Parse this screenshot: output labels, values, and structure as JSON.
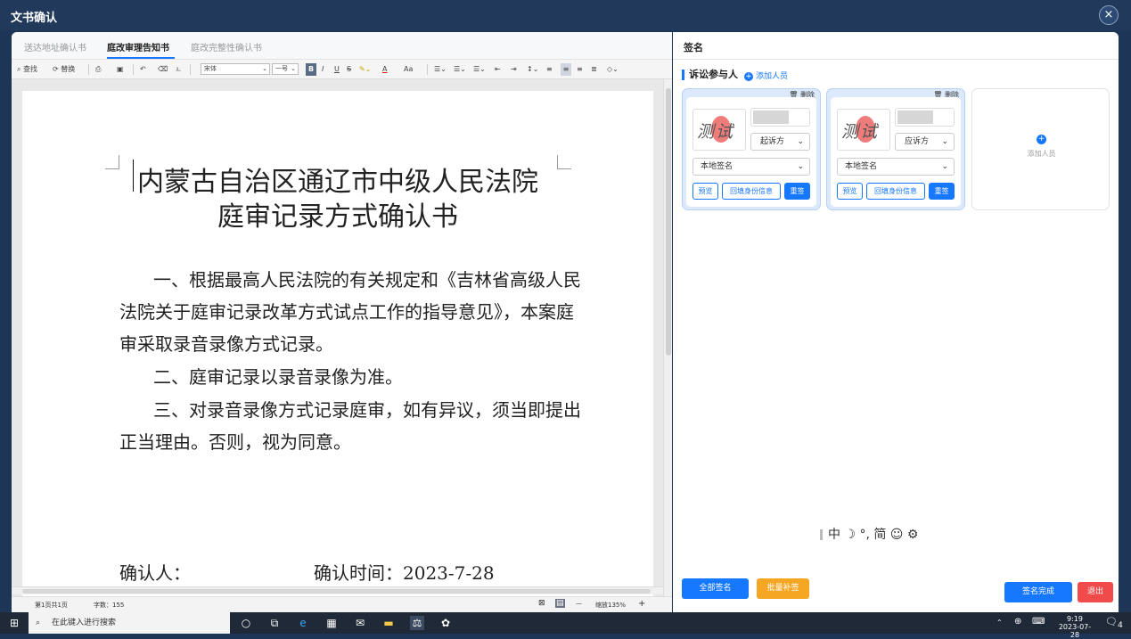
{
  "window": {
    "title": "文书确认",
    "close_icon": "×"
  },
  "tabs": [
    {
      "label": "送达地址确认书",
      "active": false
    },
    {
      "label": "庭改审理告知书",
      "active": true
    },
    {
      "label": "庭改完整性确认书",
      "active": false
    }
  ],
  "toolbar": {
    "find": "查找",
    "replace": "替换",
    "font": "宋体",
    "size": "一号",
    "bold": "B",
    "italic": "I",
    "underline": "U",
    "strike": "S",
    "font_color": "A",
    "font_case": "Aa"
  },
  "document": {
    "title_line1": "内蒙古自治区通辽市中级人民法院",
    "title_line2": "庭审记录方式确认书",
    "p1_line1": "一、根据最高人民法院的有关规定和《吉林省高级人民",
    "p1_line2": "法院关于庭审记录改革方式试点工作的指导意见》，本案庭",
    "p1_line3": "审采取录音录像方式记录。",
    "p2": "二、庭审记录以录音录像为准。",
    "p3_line1": "三、对录音录像方式记录庭审，如有异议，须当即提出",
    "p3_line2": "正当理由。否则，视为同意。",
    "confirmer_label": "确认人：",
    "confirm_time": "确认时间：2023-7-28"
  },
  "statusbar": {
    "page_info": "第1页共1页",
    "word_count": "字数：155",
    "zoom_minus": "—",
    "zoom": "缩放135%",
    "zoom_plus": "+"
  },
  "sign_panel": {
    "title": "签名",
    "section_title": "诉讼参与人",
    "add_person": "添加人员",
    "participants": [
      {
        "delete_label": "删除",
        "signature_text": "测试",
        "role": "起诉方",
        "method": "本地签名",
        "preview": "预览",
        "fill_id": "回填身份信息",
        "resign": "重签"
      },
      {
        "delete_label": "删除",
        "signature_text": "测试",
        "role": "应诉方",
        "method": "本地签名",
        "preview": "预览",
        "fill_id": "回填身份信息",
        "resign": "重签"
      }
    ],
    "add_card_label": "添加人员",
    "ime_bar": "中 ☽ °, 简 ☺ ⚙",
    "all_sign": "全部签名",
    "batch_sign": "批量补签",
    "sign_done": "签名完成",
    "exit": "退出"
  },
  "taskbar": {
    "search_placeholder": "在此键入进行搜索",
    "time": "9:19",
    "date": "2023-07-28",
    "notification_count": "4"
  },
  "colors": {
    "accent": "#1677ff",
    "orange": "#f5a623",
    "red": "#f04a4a",
    "titlebar": "#213a5c"
  }
}
